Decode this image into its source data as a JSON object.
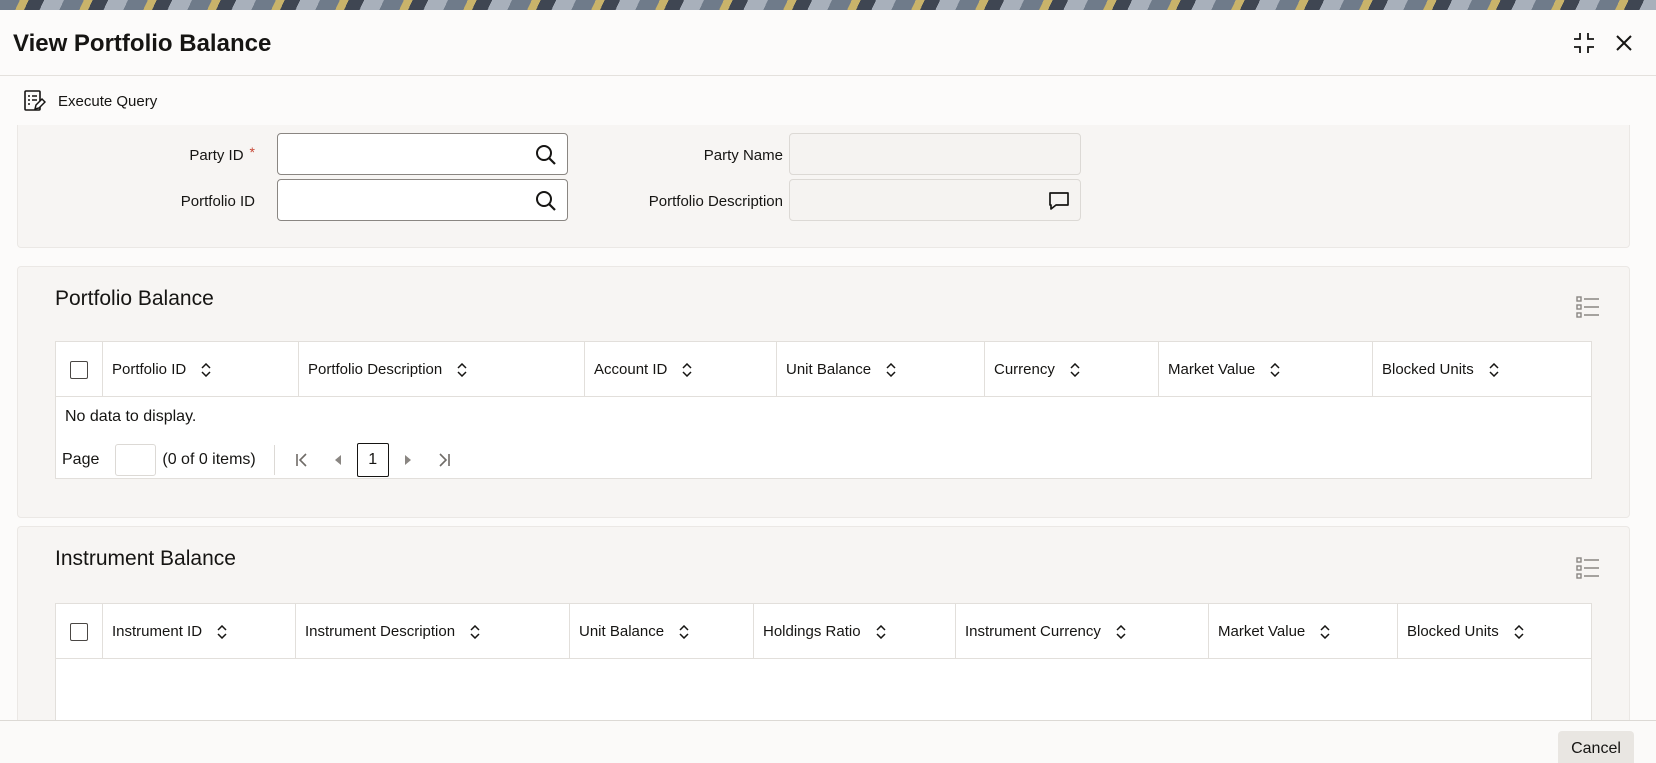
{
  "window": {
    "title": "View Portfolio Balance",
    "icons": {
      "maximize": "collapse-icon",
      "close": "close-icon"
    }
  },
  "toolbar": {
    "execute_query_label": "Execute Query",
    "execute_query_icon": "query-icon"
  },
  "form": {
    "party_id": {
      "label": "Party ID",
      "required_mark": "*",
      "value": "",
      "icon": "search-icon"
    },
    "portfolio_id": {
      "label": "Portfolio ID",
      "value": "",
      "icon": "search-icon"
    },
    "party_name": {
      "label": "Party Name",
      "value": ""
    },
    "portfolio_description": {
      "label": "Portfolio Description",
      "value": "",
      "icon": "comment-icon"
    }
  },
  "portfolio_balance": {
    "title": "Portfolio Balance",
    "columns": [
      "Portfolio ID",
      "Portfolio Description",
      "Account ID",
      "Unit Balance",
      "Currency",
      "Market Value",
      "Blocked Units"
    ],
    "rows": [],
    "empty_message": "No data to display.",
    "pager": {
      "page_label": "Page",
      "page_value": "",
      "count_text": "(0 of 0 items)",
      "current_page": "1"
    }
  },
  "instrument_balance": {
    "title": "Instrument Balance",
    "columns": [
      "Instrument ID",
      "Instrument Description",
      "Unit Balance",
      "Holdings Ratio",
      "Instrument Currency",
      "Market Value",
      "Blocked Units"
    ],
    "rows": []
  },
  "footer": {
    "cancel_label": "Cancel"
  },
  "colors": {
    "accent_required": "#c74634",
    "panel_bg": "#f7f5f3",
    "text": "#161513"
  }
}
